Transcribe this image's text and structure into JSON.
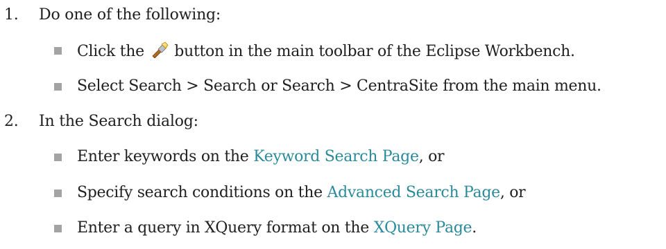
{
  "steps": [
    {
      "number": "1.",
      "text": "Do one of the following:",
      "items": [
        {
          "before": "Click the",
          "icon": "search-flashlight-icon",
          "after": "button in the main toolbar of the Eclipse Workbench."
        },
        {
          "text": "Select Search > Search or Search > CentraSite from the main menu."
        }
      ]
    },
    {
      "number": "2.",
      "text": "In the Search dialog:",
      "items": [
        {
          "before": "Enter keywords on the",
          "link": "Keyword Search Page",
          "after": ", or"
        },
        {
          "before": "Specify search conditions on the",
          "link": "Advanced Search Page",
          "after": ", or"
        },
        {
          "before": "Enter a query in XQuery format on the",
          "link": "XQuery Page",
          "after": "."
        }
      ]
    }
  ],
  "colors": {
    "text": "#1f1f1f",
    "link": "#2a8a9a",
    "bullet": "#a3a3a3"
  }
}
